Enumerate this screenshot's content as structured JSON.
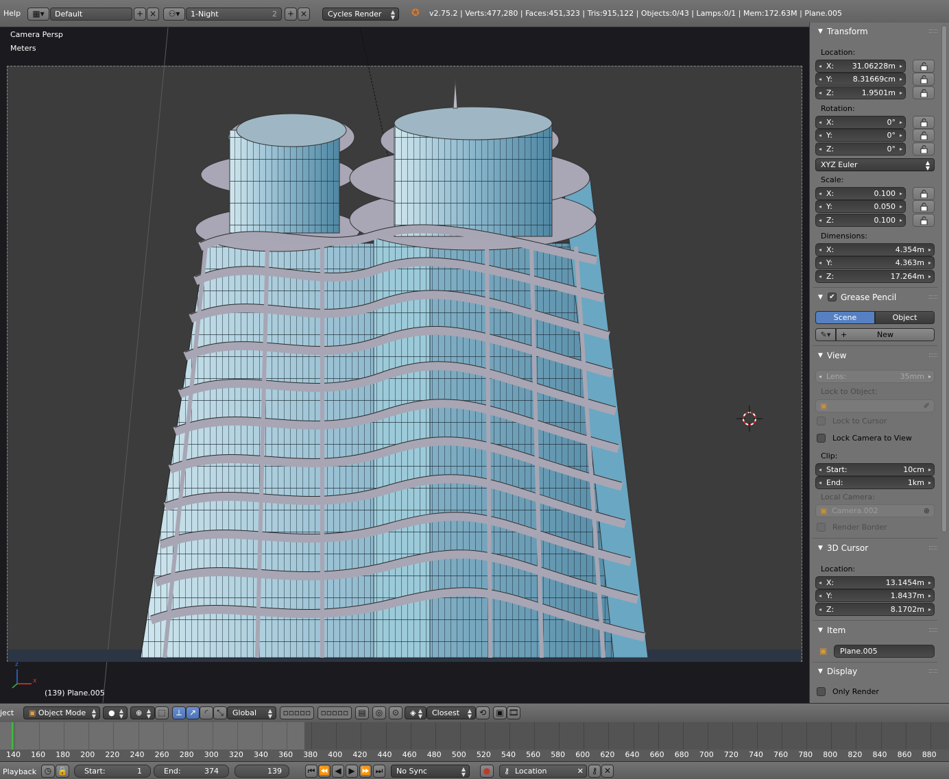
{
  "topbar": {
    "help_menu": "Help",
    "screen_layout": "Default",
    "scene_name": "1-Night",
    "scene_users": "2",
    "render_engine": "Cycles Render",
    "stats": "v2.75.2 | Verts:477,280 | Faces:451,323 | Tris:915,122 | Objects:0/43 | Lamps:0/1 | Mem:172.63M | Plane.005"
  },
  "viewport": {
    "view_name": "Camera Persp",
    "units": "Meters",
    "object_info": "(139) Plane.005",
    "axis_x": "x",
    "axis_z": "z",
    "colors": {
      "background": "#1b1b1f",
      "camera_area": "#3c3c3c",
      "glass": "#8fbcd0",
      "frame": "#a8a6b4"
    }
  },
  "npanel": {
    "transform": {
      "title": "Transform",
      "location_label": "Location:",
      "location": [
        {
          "axis": "X:",
          "value": "31.06228m"
        },
        {
          "axis": "Y:",
          "value": "8.31669cm"
        },
        {
          "axis": "Z:",
          "value": "1.9501m"
        }
      ],
      "rotation_label": "Rotation:",
      "rotation": [
        {
          "axis": "X:",
          "value": "0°"
        },
        {
          "axis": "Y:",
          "value": "0°"
        },
        {
          "axis": "Z:",
          "value": "0°"
        }
      ],
      "rotation_mode": "XYZ Euler",
      "scale_label": "Scale:",
      "scale": [
        {
          "axis": "X:",
          "value": "0.100"
        },
        {
          "axis": "Y:",
          "value": "0.050"
        },
        {
          "axis": "Z:",
          "value": "0.100"
        }
      ],
      "dimensions_label": "Dimensions:",
      "dimensions": [
        {
          "axis": "X:",
          "value": "4.354m"
        },
        {
          "axis": "Y:",
          "value": "4.363m"
        },
        {
          "axis": "Z:",
          "value": "17.264m"
        }
      ]
    },
    "grease_pencil": {
      "title": "Grease Pencil",
      "enabled": true,
      "tab_scene": "Scene",
      "tab_object": "Object",
      "new_button": "New"
    },
    "view": {
      "title": "View",
      "lens_label": "Lens:",
      "lens_value": "35mm",
      "lock_object_label": "Lock to Object:",
      "lock_to_cursor": "Lock to Cursor",
      "lock_camera_to_view": "Lock Camera to View",
      "clip_label": "Clip:",
      "clip_start_label": "Start:",
      "clip_start": "10cm",
      "clip_end_label": "End:",
      "clip_end": "1km",
      "local_camera_label": "Local Camera:",
      "local_camera": "Camera.002",
      "render_border": "Render Border"
    },
    "cursor": {
      "title": "3D Cursor",
      "location_label": "Location:",
      "location": [
        {
          "axis": "X:",
          "value": "13.1454m"
        },
        {
          "axis": "Y:",
          "value": "1.8437m"
        },
        {
          "axis": "Z:",
          "value": "8.1702m"
        }
      ]
    },
    "item": {
      "title": "Item",
      "name": "Plane.005"
    },
    "display": {
      "title": "Display",
      "only_render": "Only Render"
    }
  },
  "view_header": {
    "menu_object": "ject",
    "mode": "Object Mode",
    "orientation": "Global",
    "snap_target": "Closest"
  },
  "timeline": {
    "current_frame": 139,
    "ticks": [
      "140",
      "160",
      "180",
      "200",
      "220",
      "240",
      "260",
      "280",
      "300",
      "320",
      "340",
      "360",
      "380",
      "400",
      "420",
      "440",
      "460",
      "480",
      "500",
      "520",
      "540",
      "560",
      "580",
      "600",
      "620",
      "640",
      "660",
      "680",
      "700",
      "720",
      "740",
      "760",
      "780",
      "800",
      "820",
      "840",
      "860",
      "880"
    ]
  },
  "timeline_header": {
    "playback_menu": "Playback",
    "start_label": "Start:",
    "start_value": "1",
    "end_label": "End:",
    "end_value": "374",
    "current_frame": "139",
    "sync_mode": "No Sync",
    "keying_set": "Location"
  }
}
